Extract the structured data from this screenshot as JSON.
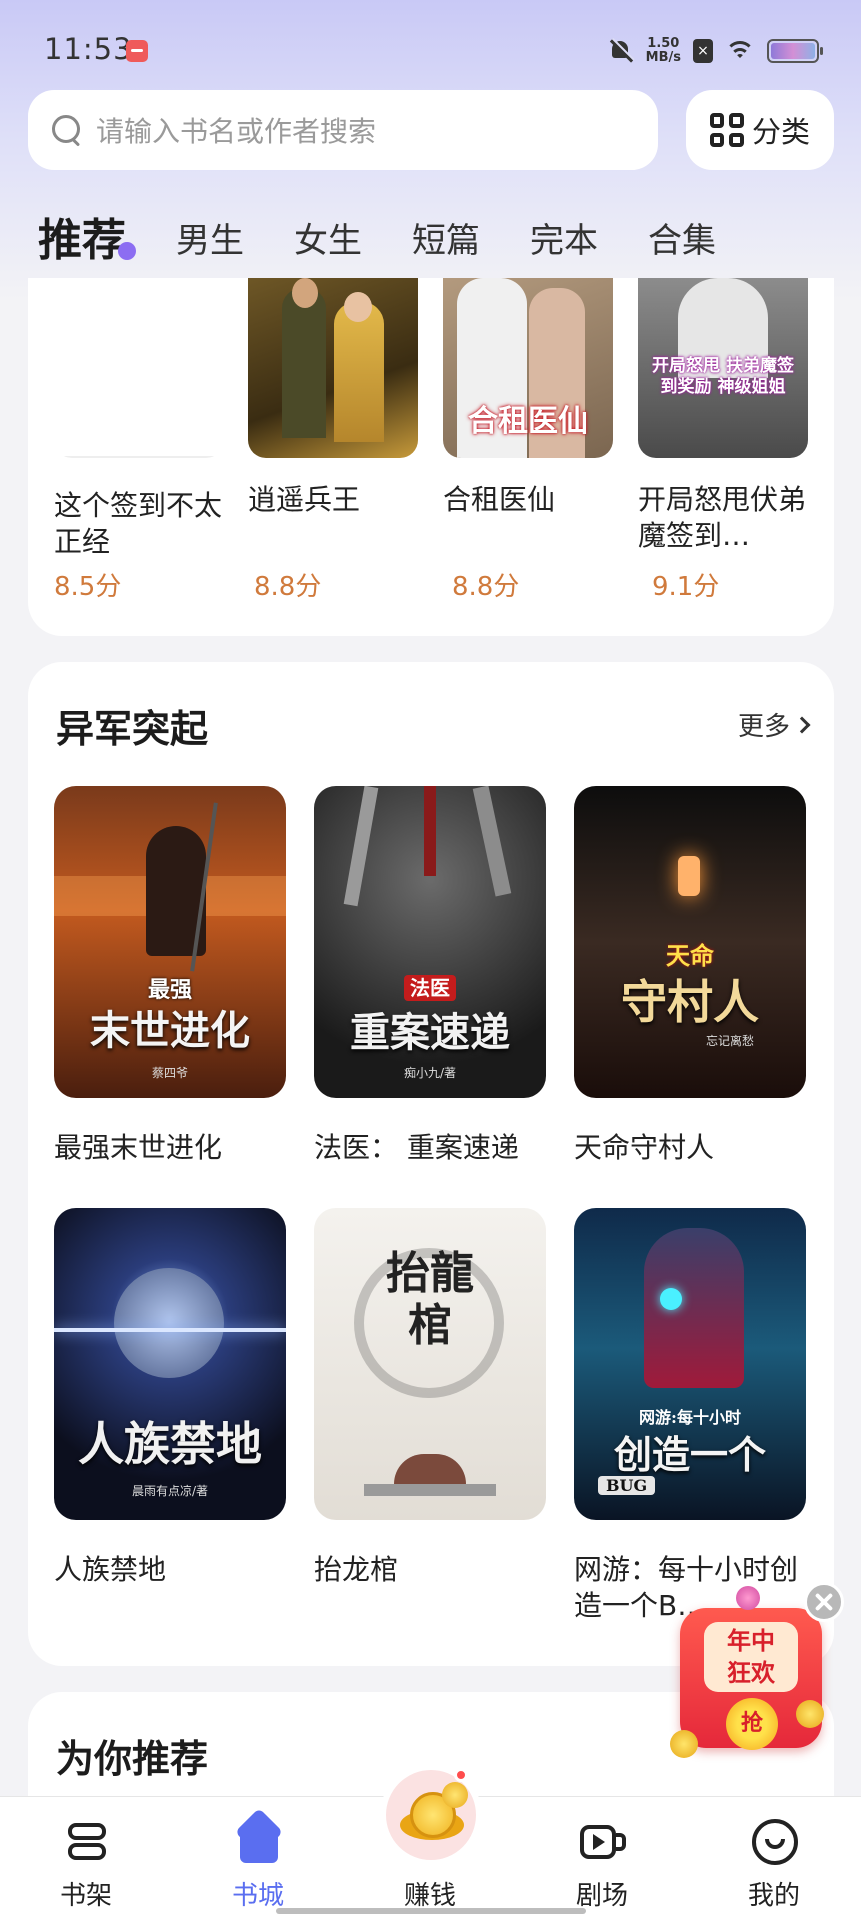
{
  "status_bar": {
    "time": "11:53",
    "net_speed_value": "1.50",
    "net_speed_unit": "MB/s",
    "sim_label": "×"
  },
  "search": {
    "placeholder": "请输入书名或作者搜索"
  },
  "category_button": {
    "label": "分类"
  },
  "tabs": [
    {
      "label": "推荐",
      "active": true
    },
    {
      "label": "男生"
    },
    {
      "label": "女生"
    },
    {
      "label": "短篇"
    },
    {
      "label": "完本"
    },
    {
      "label": "合集"
    }
  ],
  "top_strip": [
    {
      "title": "这个签到不太正经",
      "score": "8.5分"
    },
    {
      "title": "逍遥兵王",
      "score": "8.8分"
    },
    {
      "title": "合租医仙",
      "score": "8.8分",
      "cover_text": "合租医仙"
    },
    {
      "title": "开局怒甩伏弟魔签到…",
      "score": "9.1分",
      "cover_text": "开局怒甩 扶弟魔签到奖励 神级姐姐"
    }
  ],
  "section": {
    "title": "异军突起",
    "more_label": "更多",
    "books": [
      {
        "title": "最强末世进化",
        "cover_text_small": "最强",
        "cover_text": "末世进化",
        "cover_author": "蔡四爷"
      },
      {
        "title": "法医： 重案速递",
        "cover_text_small": "法医",
        "cover_text": "重案速递",
        "cover_author": "痴小九/著"
      },
      {
        "title": "天命守村人",
        "cover_text_small": "天命",
        "cover_text": "守村人",
        "cover_author": "忘记离愁"
      },
      {
        "title": "人族禁地",
        "cover_text": "人族禁地",
        "cover_author": "晨雨有点凉/著"
      },
      {
        "title": "抬龙棺",
        "cover_text": "抬龍棺"
      },
      {
        "title": "网游：每十小时创造一个B…",
        "cover_text_small": "网游:每十小时",
        "cover_text": "创造一个",
        "cover_tag": "BUG"
      }
    ]
  },
  "recommend": {
    "title": "为你推荐"
  },
  "promo": {
    "line1": "年中",
    "line2": "狂欢",
    "grab": "抢"
  },
  "bottom_nav": [
    {
      "label": "书架",
      "icon": "bookshelf-icon"
    },
    {
      "label": "书城",
      "icon": "home-icon",
      "active": true
    },
    {
      "label": "赚钱",
      "icon": "coins-icon"
    },
    {
      "label": "剧场",
      "icon": "video-icon"
    },
    {
      "label": "我的",
      "icon": "smile-icon"
    }
  ],
  "colors": {
    "accent": "#5a6ef0",
    "score": "#d07a3c",
    "tab_dot": "#8c6df2"
  }
}
